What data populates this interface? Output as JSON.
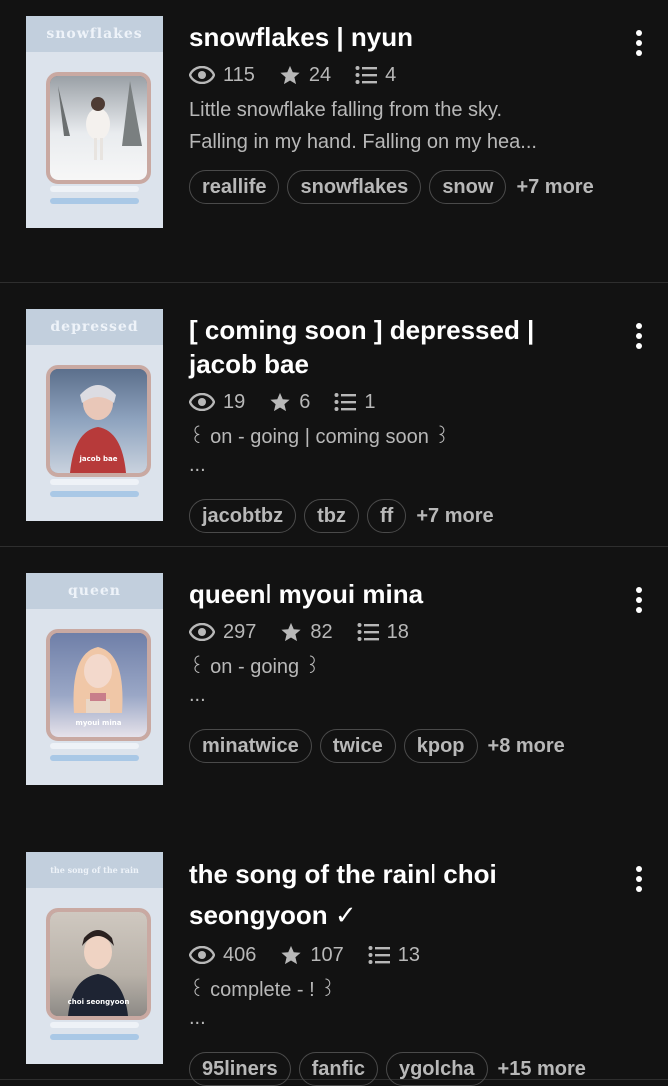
{
  "stories": [
    {
      "cover_text": "snowflakes",
      "cover_caption": "",
      "title": "snowflakes | nyun",
      "title_suffix": "",
      "reads": "115",
      "votes": "24",
      "parts": "4",
      "desc_line1": "Little snowflake falling from the sky.",
      "desc_line2": "Falling in my hand. Falling on my hea...",
      "tags": [
        "reallife",
        "snowflakes",
        "snow"
      ],
      "more": "+7 more"
    },
    {
      "cover_text": "depressed",
      "cover_caption": "jacob bae",
      "title": "[ coming soon ] depressed |",
      "title_line2": "jacob bae",
      "reads": "19",
      "votes": "6",
      "parts": "1",
      "desc_line1": "꒰ on - going | coming soon ꒱",
      "desc_line2": "...",
      "tags": [
        "jacobtbz",
        "tbz",
        "ff"
      ],
      "more": "+7 more"
    },
    {
      "cover_text": "queen",
      "cover_caption": "myoui mina",
      "title": "queen",
      "title_light": "l",
      "title_rest": " myoui mina",
      "reads": "297",
      "votes": "82",
      "parts": "18",
      "desc_line1": "꒰ on - going ꒱",
      "desc_line2": "...",
      "tags": [
        "minatwice",
        "twice",
        "kpop"
      ],
      "more": "+8 more"
    },
    {
      "cover_text": "the song of the rain",
      "cover_caption": "choi seongyoon",
      "title": "the song of the rain",
      "title_light": "l",
      "title_rest": " choi",
      "title_line2": "seongyoon ✓",
      "reads": "406",
      "votes": "107",
      "parts": "13",
      "desc_line1": "꒰ complete - ! ꒱",
      "desc_line2": "...",
      "tags": [
        "95liners",
        "fanfic",
        "ygolcha"
      ],
      "more": "+15 more"
    }
  ],
  "icons": {
    "reads": "eye-icon",
    "votes": "star-icon",
    "parts": "list-icon",
    "menu": "more-vertical-icon"
  },
  "colors": {
    "background": "#121212",
    "text": "#ffffff",
    "muted": "#b8b8b8",
    "tag_border": "#4a4a4a",
    "cover_bg": "#dce3ec"
  }
}
